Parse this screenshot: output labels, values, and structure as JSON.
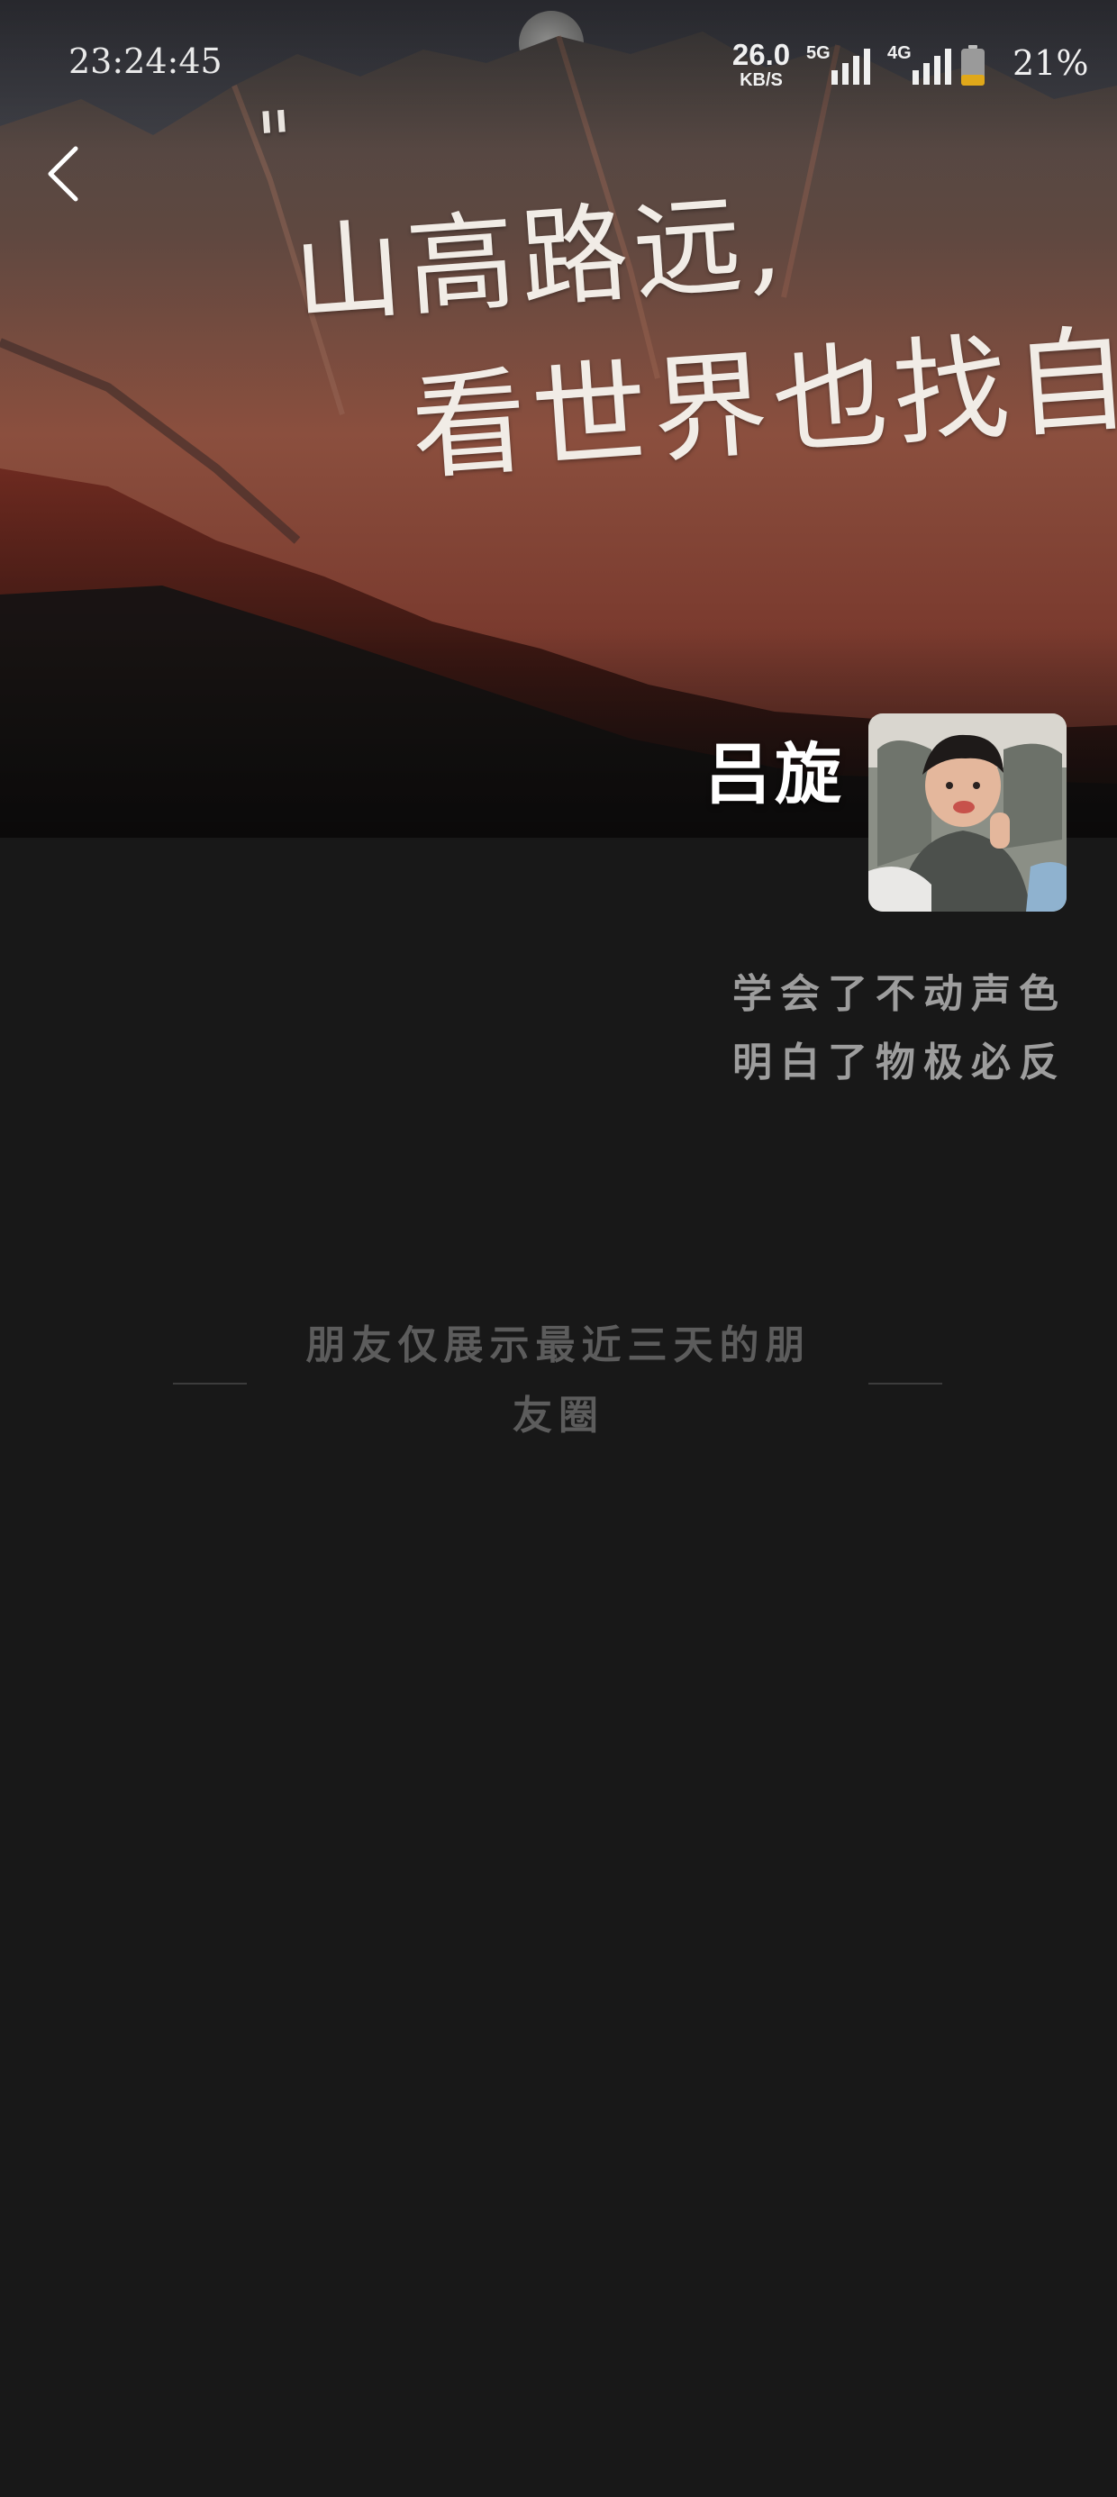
{
  "status_bar": {
    "time": "23:24:45",
    "net_speed": "26.0",
    "net_speed_unit": "KB/S",
    "sim1_type": "5G",
    "sim2_type": "4G",
    "battery": "21%"
  },
  "cover": {
    "quote_mark": "\"",
    "quote_line1": "山高路远,",
    "quote_line2": "看世界也找自己。"
  },
  "profile": {
    "name": "吕旋",
    "signature_line1": "学会了不动声色",
    "signature_line2": "明白了物极必反"
  },
  "notice": {
    "text": "朋友仅展示最近三天的朋友圈"
  },
  "colors": {
    "background": "#181818",
    "signature_text": "#9d9d9d",
    "notice_text": "#5c5c5c",
    "battery_fill": "#e0a81a"
  },
  "icons": {
    "back": "chevron-left-icon",
    "battery": "battery-icon",
    "signal": "signal-icon"
  }
}
